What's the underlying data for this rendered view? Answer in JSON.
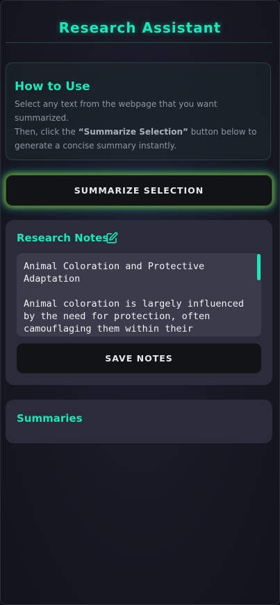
{
  "header": {
    "title": "Research Assistant"
  },
  "how_to": {
    "heading": "How to Use",
    "line1": "Select any text from the webpage that you want summarized.",
    "line2_prefix": "Then, click the ",
    "line2_strong": "“Summarize Selection”",
    "line2_suffix": " button below to generate a concise summary instantly."
  },
  "actions": {
    "summarize_label": "SUMMARIZE SELECTION"
  },
  "notes": {
    "heading": "Research Notes",
    "edit_icon": "edit-icon",
    "content": "Animal Coloration and Protective Adaptation\n\nAnimal coloration is largely influenced by the need for protection, often camouflaging them within their",
    "save_label": "SAVE NOTES"
  },
  "summaries": {
    "heading": "Summaries"
  },
  "colors": {
    "accent": "#1de6b9",
    "glow_green": "#96e628",
    "card_bg": "#2a2c3b",
    "button_bg": "#121317"
  }
}
